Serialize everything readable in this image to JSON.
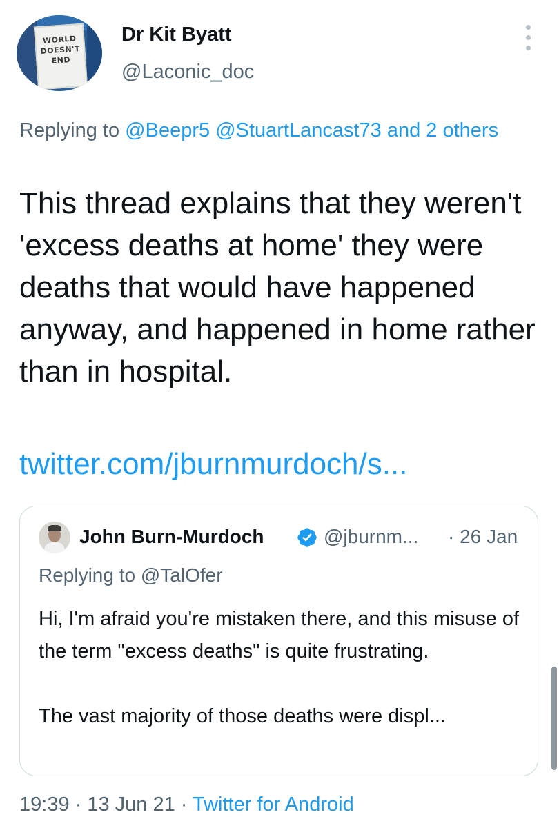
{
  "author": {
    "avatar_sign_lines": [
      "WORLD",
      "DOESN'T",
      "END"
    ],
    "display_name": "Dr Kit Byatt",
    "handle": "@Laconic_doc"
  },
  "reply_line": {
    "prefix": "Replying to ",
    "mentions": "@Beepr5 @StuartLancast73 and 2 others"
  },
  "tweet": {
    "text": "This thread explains that they weren't 'excess deaths at home' they were deaths that would have happened anyway, and happened in home rather than in hospital.",
    "link": "twitter.com/jburnmurdoch/s..."
  },
  "quoted_tweet": {
    "name": "John Burn-Murdoch",
    "handle": "@jburnm...",
    "date": "· 26 Jan",
    "reply_prefix": "Replying to ",
    "reply_mention": "@TalOfer",
    "paragraph_1": "Hi, I'm afraid you're mistaken there, and this misuse of the term \"excess deaths\" is quite frustrating.",
    "paragraph_2": "The vast majority of those deaths were displ..."
  },
  "footer": {
    "time": "19:39",
    "sep1": " · ",
    "date": "13 Jun 21",
    "sep2": " · ",
    "source": "Twitter for Android"
  },
  "icons": {
    "more": "more-vertical-icon",
    "verified": "verified-badge-icon"
  },
  "colors": {
    "link": "#1d9bf0",
    "secondary_text": "#536471",
    "primary_text": "#0f1419",
    "border": "#cfd9de"
  }
}
